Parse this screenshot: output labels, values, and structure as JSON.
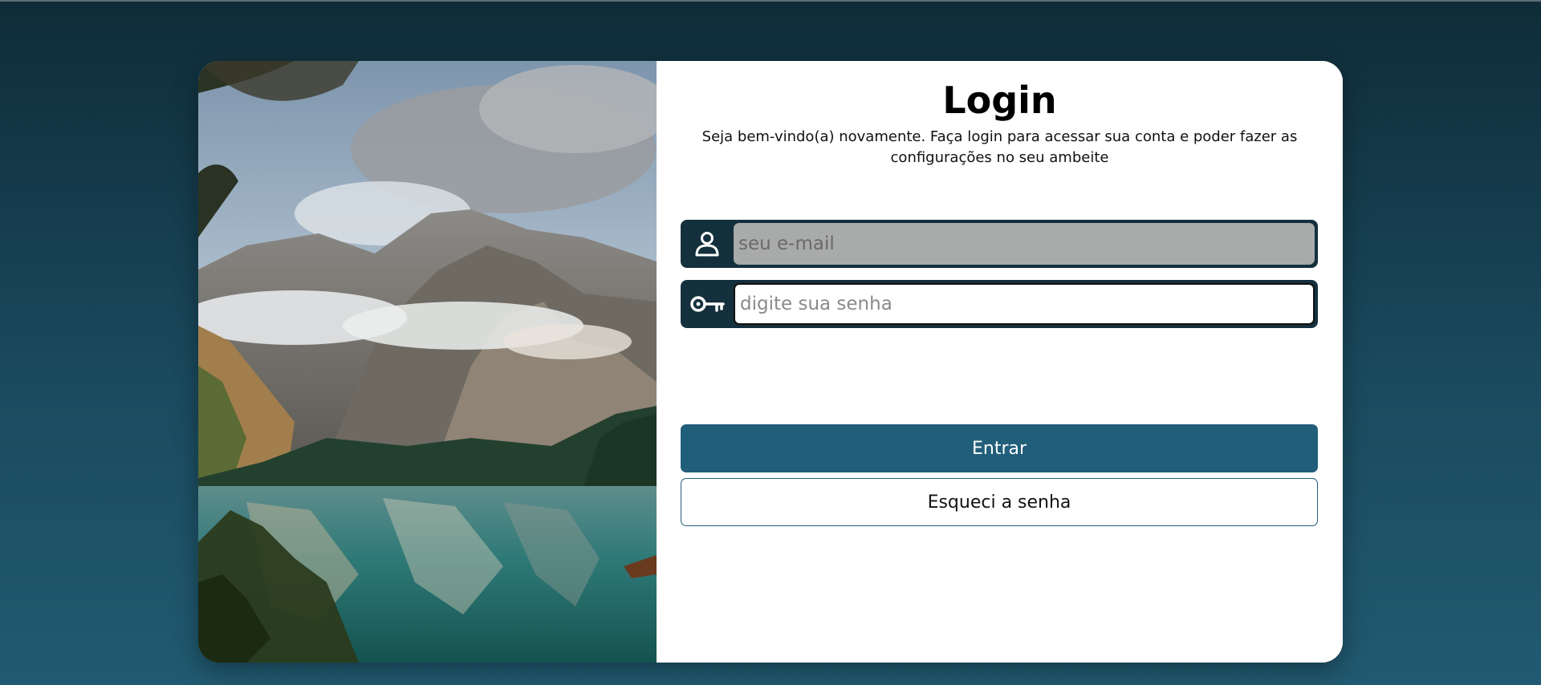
{
  "login": {
    "title": "Login",
    "subtitle": "Seja bem-vindo(a) novamente. Faça login para acessar sua conta e poder fazer as configurações no seu ambeite",
    "email": {
      "placeholder": "seu e-mail",
      "value": "",
      "icon": "user-icon"
    },
    "password": {
      "placeholder": "digite sua senha",
      "value": "",
      "icon": "key-icon"
    },
    "submit_label": "Entrar",
    "forgot_label": "Esqueci a senha"
  },
  "colors": {
    "background_top": "#0f2c38",
    "background_bottom": "#215a71",
    "field_dark": "#14303d",
    "primary": "#215e7a"
  },
  "image": {
    "icon": "landscape-photo"
  }
}
